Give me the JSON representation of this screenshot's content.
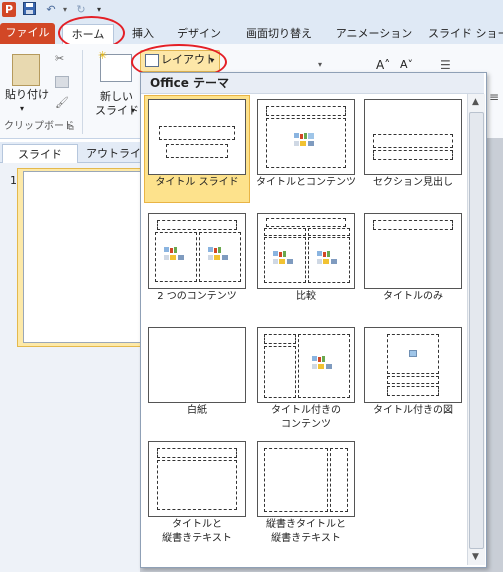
{
  "quick_access": {
    "app_icon": "P",
    "save_icon": "save-icon",
    "undo_icon": "undo-icon",
    "redo_icon": "redo-icon",
    "customize_icon": "customize-icon"
  },
  "tabs": [
    {
      "label": "ファイル"
    },
    {
      "label": "ホーム"
    },
    {
      "label": "挿入"
    },
    {
      "label": "デザイン"
    },
    {
      "label": "画面切り替え"
    },
    {
      "label": "アニメーション"
    },
    {
      "label": "スライド ショー"
    }
  ],
  "ribbon": {
    "paste_label": "貼り付け",
    "clipboard_group": "クリップボード",
    "new_slide_line1": "新しい",
    "new_slide_line2": "スライド",
    "layout_label": "レイアウト"
  },
  "slides_pane": {
    "tab_slides": "スライド",
    "tab_outline": "アウトライン",
    "slide_number": "1"
  },
  "gallery": {
    "title": "Office テーマ",
    "items": [
      {
        "label": "タイトル スライド"
      },
      {
        "label": "タイトルとコンテンツ"
      },
      {
        "label": "セクション見出し"
      },
      {
        "label": "2 つのコンテンツ"
      },
      {
        "label": "比較"
      },
      {
        "label": "タイトルのみ"
      },
      {
        "label": "白紙"
      },
      {
        "label": "タイトル付きの\nコンテンツ"
      },
      {
        "label": "タイトル付きの図"
      },
      {
        "label": "タイトルと\n縦書きテキスト"
      },
      {
        "label": "縦書きタイトルと\n縦書きテキスト"
      }
    ],
    "selected_index": 0
  },
  "colors": {
    "file_tab": "#d24726",
    "highlight_ring": "#e41f26",
    "selected_item": "#fde28c",
    "ribbon_bg": "#dfe9f5"
  }
}
